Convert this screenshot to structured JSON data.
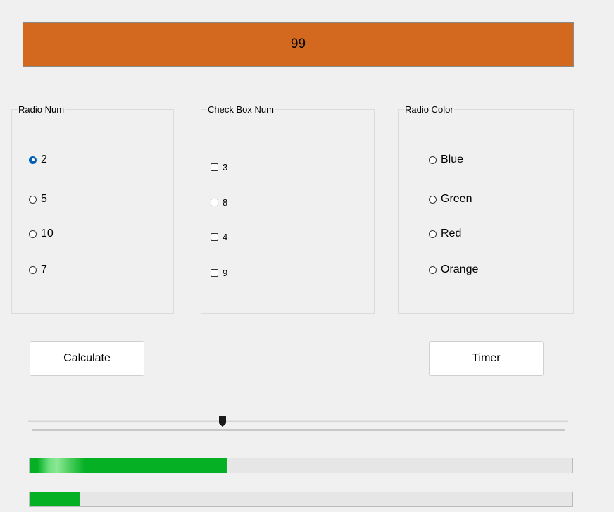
{
  "display": {
    "value": "99",
    "background": "#d2691e"
  },
  "radio_num": {
    "legend": "Radio Num",
    "options": [
      {
        "label": "2",
        "checked": true
      },
      {
        "label": "5",
        "checked": false
      },
      {
        "label": "10",
        "checked": false
      },
      {
        "label": "7",
        "checked": false
      }
    ]
  },
  "check_box_num": {
    "legend": "Check Box Num",
    "options": [
      {
        "label": "3",
        "checked": false
      },
      {
        "label": "8",
        "checked": false
      },
      {
        "label": "4",
        "checked": false
      },
      {
        "label": "9",
        "checked": false
      }
    ]
  },
  "radio_color": {
    "legend": "Radio Color",
    "options": [
      {
        "label": "Blue",
        "checked": false
      },
      {
        "label": "Green",
        "checked": false
      },
      {
        "label": "Red",
        "checked": false
      },
      {
        "label": "Orange",
        "checked": false
      }
    ]
  },
  "buttons": {
    "calculate": "Calculate",
    "timer": "Timer"
  },
  "slider": {
    "value_fraction": 0.36
  },
  "progress_bars": [
    {
      "value_fraction": 0.363,
      "color": "#06b025"
    },
    {
      "value_fraction": 0.093,
      "color": "#06b025"
    }
  ],
  "colors": {
    "window_background": "#f0f0f0",
    "radio_checked": "#005fb8",
    "progress_green": "#06b025"
  }
}
